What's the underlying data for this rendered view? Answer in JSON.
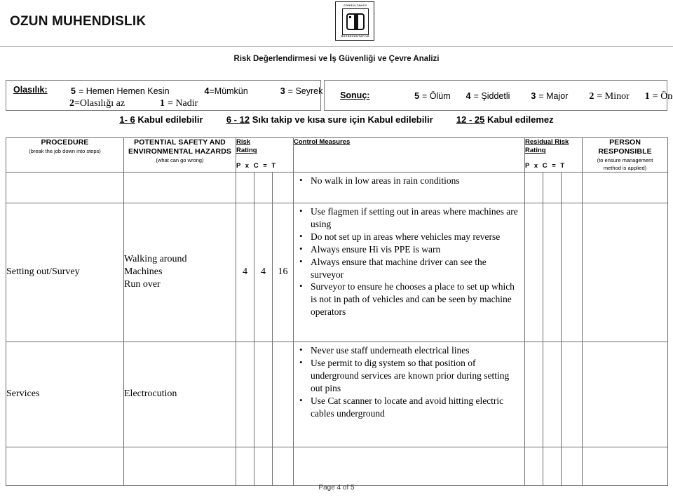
{
  "header": {
    "company_name": "OZUN MUHENDISLIK",
    "logo": {
      "text_top": "CONSULTANCY",
      "text_bottom": "REPRESENTATIVE"
    }
  },
  "doc_title": "Risk Değerlendirmesi ve İş Güvenliği ve Çevre Analizi",
  "legend": {
    "probability": {
      "label": "Olasılık:",
      "line1": [
        {
          "num": "5",
          "eq": "= Hemen Hemen Kesin"
        },
        {
          "num": "4",
          "eq": "=Mümkün"
        },
        {
          "num": "3",
          "eq": "= Seyrek"
        }
      ],
      "line2": [
        {
          "num": "2",
          "eq": "=Olasılığı az"
        },
        {
          "num": "1",
          "eq": "= Nadir"
        }
      ]
    },
    "consequence": {
      "label": "Sonuç:",
      "items": [
        {
          "num": "5",
          "eq": "= Ölüm"
        },
        {
          "num": "4",
          "eq": "= Şiddetli"
        },
        {
          "num": "3",
          "eq": "= Major"
        },
        {
          "num": "2",
          "eq": "= Minor"
        },
        {
          "num": "1",
          "eq": "= Önemsiz"
        }
      ]
    }
  },
  "acceptability": [
    {
      "range": "1- 6",
      "text": "Kabul edilebilir"
    },
    {
      "range": "6 - 12",
      "text": "Sıkı takip ve kısa sure için Kabul edilebilir"
    },
    {
      "range": "12 - 25",
      "text": "Kabul edilemez"
    }
  ],
  "table": {
    "headers": {
      "procedure": {
        "main": "PROCEDURE",
        "sub": "(break the job down into steps)"
      },
      "hazards": {
        "main": "POTENTIAL SAFETY AND ENVIRONMENTAL HAZARDS",
        "sub": "(what can go wrong)"
      },
      "risk_rating": {
        "line1": "Risk",
        "line2": "Rating",
        "formula": "P  x  C  = T"
      },
      "control_measures": "Control Measures",
      "residual_risk": {
        "line1": "Residual Risk",
        "line2": "Rating",
        "formula": "P  x  C  = T"
      },
      "person_responsible": {
        "main_line1": "PERSON",
        "main_line2": "RESPONSIBLE",
        "sub_line1": "(to ensure management",
        "sub_line2": "method is applied)"
      }
    },
    "rows": [
      {
        "procedure": "",
        "hazards": "",
        "p": "",
        "c": "",
        "t": "",
        "measures": [
          "No walk in low areas in rain conditions"
        ],
        "rp": "",
        "rc": "",
        "rt": "",
        "person": ""
      },
      {
        "procedure": "Setting out/Survey",
        "hazards_lines": [
          "Walking around",
          "Machines",
          "Run over"
        ],
        "p": "4",
        "c": "4",
        "t": "16",
        "measures": [
          "Use flagmen if setting out in areas where machines are using",
          "Do not set up in areas where vehicles may reverse",
          "Always ensure Hi vis PPE is warn",
          "Always ensure that machine driver can see the surveyor",
          "Surveyor to ensure he chooses a place to set up which is not in path of vehicles and can be seen by machine operators"
        ],
        "rp": "",
        "rc": "",
        "rt": "",
        "person": ""
      },
      {
        "procedure": "Services",
        "hazards_lines": [
          "Electrocution"
        ],
        "p": "",
        "c": "",
        "t": "",
        "measures": [
          "Never use staff underneath electrical lines",
          "Use permit to dig system so that position of underground services are known prior during setting out pins",
          "Use Cat scanner to locate and avoid hitting electric cables underground"
        ],
        "rp": "",
        "rc": "",
        "rt": "",
        "person": ""
      },
      {
        "procedure": "",
        "hazards_lines": [],
        "p": "",
        "c": "",
        "t": "",
        "measures": [],
        "rp": "",
        "rc": "",
        "rt": "",
        "person": ""
      }
    ]
  },
  "footer": {
    "page_label": "Page 4 of 5"
  }
}
